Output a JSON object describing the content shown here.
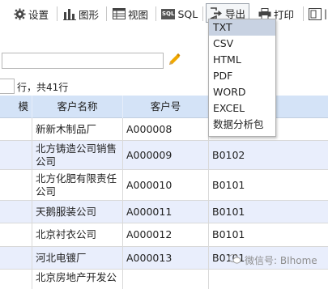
{
  "toolbar": {
    "settings_label": "设置",
    "chart_label": "图形",
    "view_label": "视图",
    "sql_icon_text": "SQL",
    "sql_label": "SQL",
    "export_label": "导出",
    "print_label": "打印"
  },
  "export_menu": {
    "items": [
      "TXT",
      "CSV",
      "HTML",
      "PDF",
      "WORD",
      "EXCEL",
      "数据分析包"
    ],
    "highlighted": "TXT"
  },
  "search": {
    "value": ""
  },
  "pager": {
    "page_value": "",
    "row_count_text": "行，共41行"
  },
  "table": {
    "columns": [
      "模",
      "客户名称",
      "客户号",
      ""
    ],
    "rows": [
      {
        "name": "新新木制品厂",
        "code": "A000008",
        "extra": ""
      },
      {
        "name": "北方铸造公司销售公司",
        "code": "A000009",
        "extra": "B0102"
      },
      {
        "name": "北方化肥有限责任公司",
        "code": "A000010",
        "extra": "B0101"
      },
      {
        "name": "天鹅服装公司",
        "code": "A000011",
        "extra": "B0101"
      },
      {
        "name": "北京衬衣公司",
        "code": "A000012",
        "extra": "B0101"
      },
      {
        "name": "河北电镀厂",
        "code": "A000013",
        "extra": "B0101"
      },
      {
        "name": "北京房地产开发公",
        "code": "",
        "extra": ""
      }
    ]
  },
  "watermark": {
    "text": "微信号: BIhome"
  },
  "colors": {
    "header_bg": "#d4e3f7",
    "alt_row_bg": "#e9eefc",
    "menu_highlight": "#c8d2e2",
    "pencil": "#f0a800"
  }
}
